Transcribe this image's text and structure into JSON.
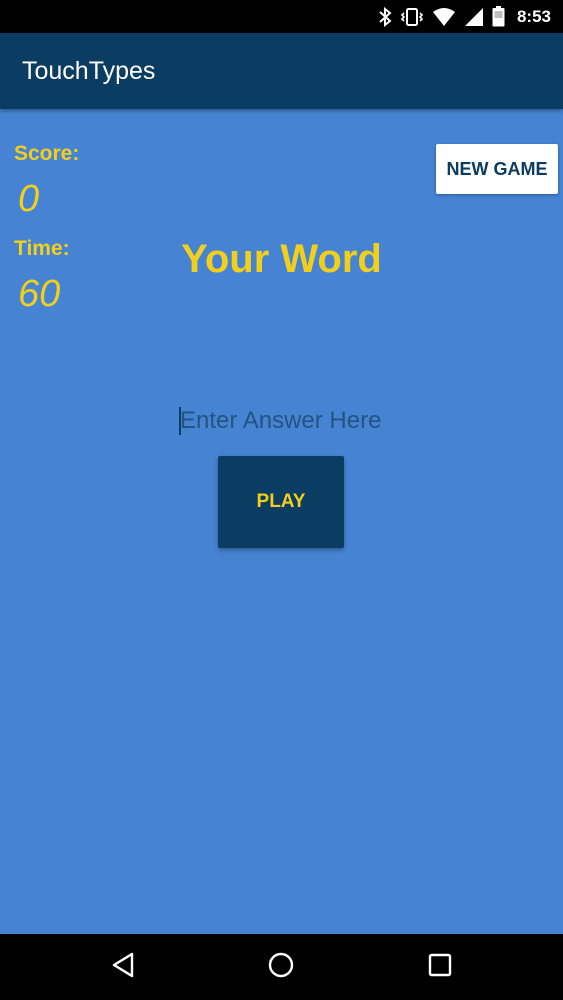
{
  "status_bar": {
    "time": "8:53",
    "icons": [
      "bluetooth-icon",
      "vibrate-icon",
      "wifi-icon",
      "signal-icon",
      "battery-icon"
    ]
  },
  "app_bar": {
    "title": "TouchTypes"
  },
  "game": {
    "score_label": "Score:",
    "score_value": "0",
    "time_label": "Time:",
    "time_value": "60",
    "word": "Your Word",
    "new_game_label": "NEW GAME",
    "answer_value": "",
    "answer_placeholder": "Enter Answer Here",
    "play_label": "PLAY"
  },
  "nav_bar": {
    "icons": [
      "back-icon",
      "home-icon",
      "recents-icon"
    ]
  },
  "colors": {
    "app_bar": "#0b3c61",
    "background": "#4684d3",
    "accent_yellow": "#f1cf1c",
    "button_white": "#ffffff"
  }
}
